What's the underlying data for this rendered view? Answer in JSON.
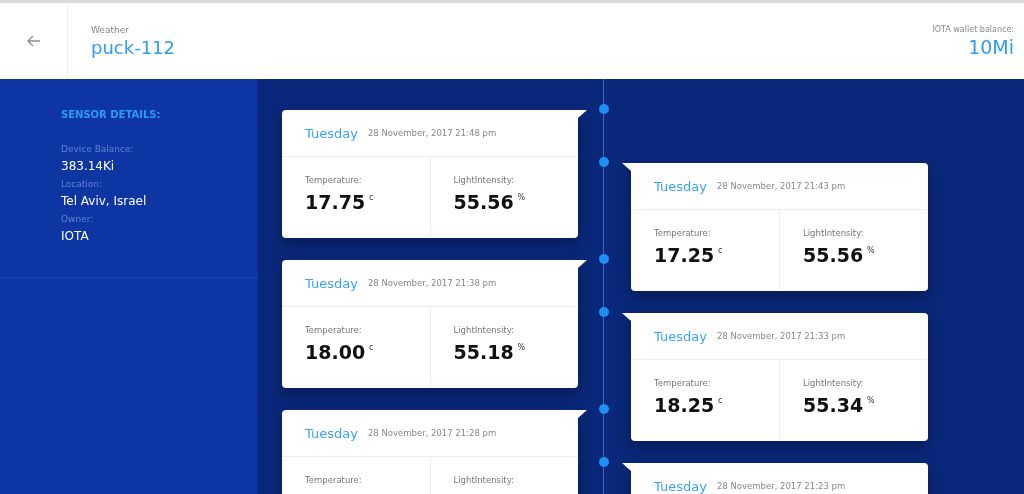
{
  "header": {
    "category": "Weather",
    "title": "puck-112",
    "wallet_label": "IOTA wallet balance:",
    "wallet_value": "10Mi"
  },
  "sensor": {
    "heading": "SENSOR DETAILS:",
    "fields": [
      {
        "label": "Device Balance:",
        "value": "383.14Ki"
      },
      {
        "label": "Location:",
        "value": "Tel Aviv, Israel"
      },
      {
        "label": "Owner:",
        "value": "IOTA"
      }
    ]
  },
  "timeline": {
    "left": [
      {
        "day": "Tuesday",
        "date": "28 November, 2017 21:48 pm",
        "temp_label": "Temperature:",
        "temp": "17.75",
        "temp_unit": "c",
        "light_label": "LightIntensity:",
        "light": "55.56",
        "light_unit": "%"
      },
      {
        "day": "Tuesday",
        "date": "28 November, 2017 21:38 pm",
        "temp_label": "Temperature:",
        "temp": "18.00",
        "temp_unit": "c",
        "light_label": "LightIntensity:",
        "light": "55.18",
        "light_unit": "%"
      },
      {
        "day": "Tuesday",
        "date": "28 November, 2017 21:28 pm",
        "temp_label": "Temperature:",
        "light_label": "LightIntensity:"
      }
    ],
    "right": [
      {
        "day": "Tuesday",
        "date": "28 November, 2017 21:43 pm",
        "temp_label": "Temperature:",
        "temp": "17.25",
        "temp_unit": "c",
        "light_label": "LightIntensity:",
        "light": "55.56",
        "light_unit": "%"
      },
      {
        "day": "Tuesday",
        "date": "28 November, 2017 21:33 pm",
        "temp_label": "Temperature:",
        "temp": "18.25",
        "temp_unit": "c",
        "light_label": "LightIntensity:",
        "light": "55.34",
        "light_unit": "%"
      },
      {
        "day": "Tuesday",
        "date": "28 November, 2017 21:23 pm"
      }
    ]
  }
}
